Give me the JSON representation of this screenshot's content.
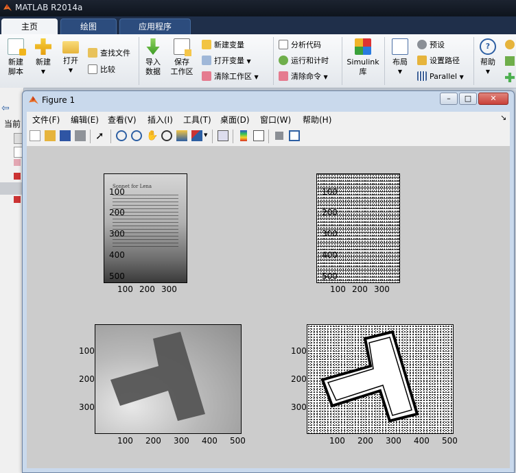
{
  "app": {
    "title": "MATLAB R2014a",
    "tabs": [
      {
        "label": "主页",
        "active": true
      },
      {
        "label": "绘图",
        "active": false
      },
      {
        "label": "应用程序",
        "active": false
      }
    ]
  },
  "ribbon": {
    "new_script": "新建\n脚本",
    "new": "新建",
    "open": "打开",
    "find_files": "查找文件",
    "compare": "比较",
    "import_data": "导入\n数据",
    "save_workspace": "保存\n工作区",
    "new_variable": "新建变量",
    "open_variable": "打开变量",
    "clear_workspace": "清除工作区",
    "analyze_code": "分析代码",
    "run_and_time": "运行和计时",
    "clear_commands": "清除命令",
    "simulink": "Simulink\n库",
    "layout": "布局",
    "preferences": "预设",
    "set_path": "设置路径",
    "parallel": "Parallel",
    "help": "帮助"
  },
  "left_strip": {
    "current_folder_fragment": "当前"
  },
  "figure": {
    "title": "Figure 1",
    "menus": [
      "文件(F)",
      "编辑(E)",
      "查看(V)",
      "插入(I)",
      "工具(T)",
      "桌面(D)",
      "窗口(W)",
      "帮助(H)"
    ],
    "window_buttons": {
      "minimize": "–",
      "maximize": "□",
      "close": "✕"
    },
    "colors": {
      "canvas": "#cccccc",
      "titlebar": "#c9d9ec",
      "close_button": "#c9413a"
    }
  },
  "axes": [
    {
      "id": "top-left",
      "content": "grayscale document photo",
      "doc_title": "Sonnet for Lena",
      "x_ticks": [
        "100",
        "200",
        "300"
      ],
      "y_ticks": [
        "100",
        "200",
        "300",
        "400",
        "500"
      ]
    },
    {
      "id": "top-right",
      "content": "binarized document",
      "x_ticks": [
        "100",
        "200",
        "300"
      ],
      "y_ticks": [
        "100",
        "200",
        "300",
        "400",
        "500"
      ]
    },
    {
      "id": "bottom-left",
      "content": "grayscale T-shape photo",
      "x_ticks": [
        "100",
        "200",
        "300",
        "400",
        "500"
      ],
      "y_ticks": [
        "100",
        "200",
        "300"
      ]
    },
    {
      "id": "bottom-right",
      "content": "binarized T-shape",
      "x_ticks": [
        "100",
        "200",
        "300",
        "400",
        "500"
      ],
      "y_ticks": [
        "100",
        "200",
        "300"
      ]
    }
  ]
}
